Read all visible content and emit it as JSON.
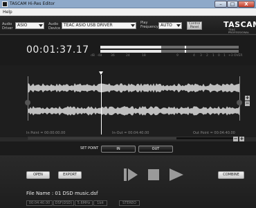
{
  "window": {
    "title": "TASCAM Hi-Res Editor",
    "min": "–",
    "max": "□",
    "close": "X"
  },
  "menu": {
    "help": "Help"
  },
  "device_bar": {
    "audio_driver_label": [
      "Audio",
      "Driver"
    ],
    "audio_driver_value": "ASIO",
    "audio_device_label": [
      "Audio",
      "Device"
    ],
    "audio_device_value": "TEAC ASIO USB DRIVER",
    "play_freq_label": [
      "Play",
      "Frequency"
    ],
    "play_freq_value": "AUTO",
    "control_panel": [
      "Control",
      "Panel"
    ],
    "logo": "TASCAM",
    "logo_sub": "TEAC PROFESSIONAL"
  },
  "display": {
    "timecode": "00:01:37.17",
    "meter_scale": [
      "dB",
      "-48",
      "36",
      "24",
      "18",
      "9",
      "4",
      "3",
      "2",
      "1",
      "0",
      "1",
      "+3",
      "OVER"
    ],
    "meter_level_top": 0.44,
    "meter_level_bottom": 0.44
  },
  "points": {
    "in": "In Point = 00:00:00.00",
    "in_out": "In-Out = 00:04:40.00",
    "out": "Out Point = 00:04:40.00"
  },
  "set_point": {
    "label": "SET POINT",
    "in": "IN",
    "out": "OUT"
  },
  "buttons": {
    "open": "OPEN",
    "export": "EXPORT",
    "combine": "COMBINE"
  },
  "transport": {
    "play_pause": "play-pause-icon",
    "stop": "stop-icon",
    "play": "play-icon"
  },
  "file": {
    "name": "File Name : 01 DSD music.dsf",
    "info": [
      "00:04:40.00",
      "DSF(DSD)",
      "5.6MHz",
      "1bit",
      "STEREO"
    ]
  },
  "colors": {
    "panel": "#1e1e1e",
    "waveform": "#bfbfbf",
    "titlebar": "#8ea9c9",
    "close": "#c33c2a"
  }
}
